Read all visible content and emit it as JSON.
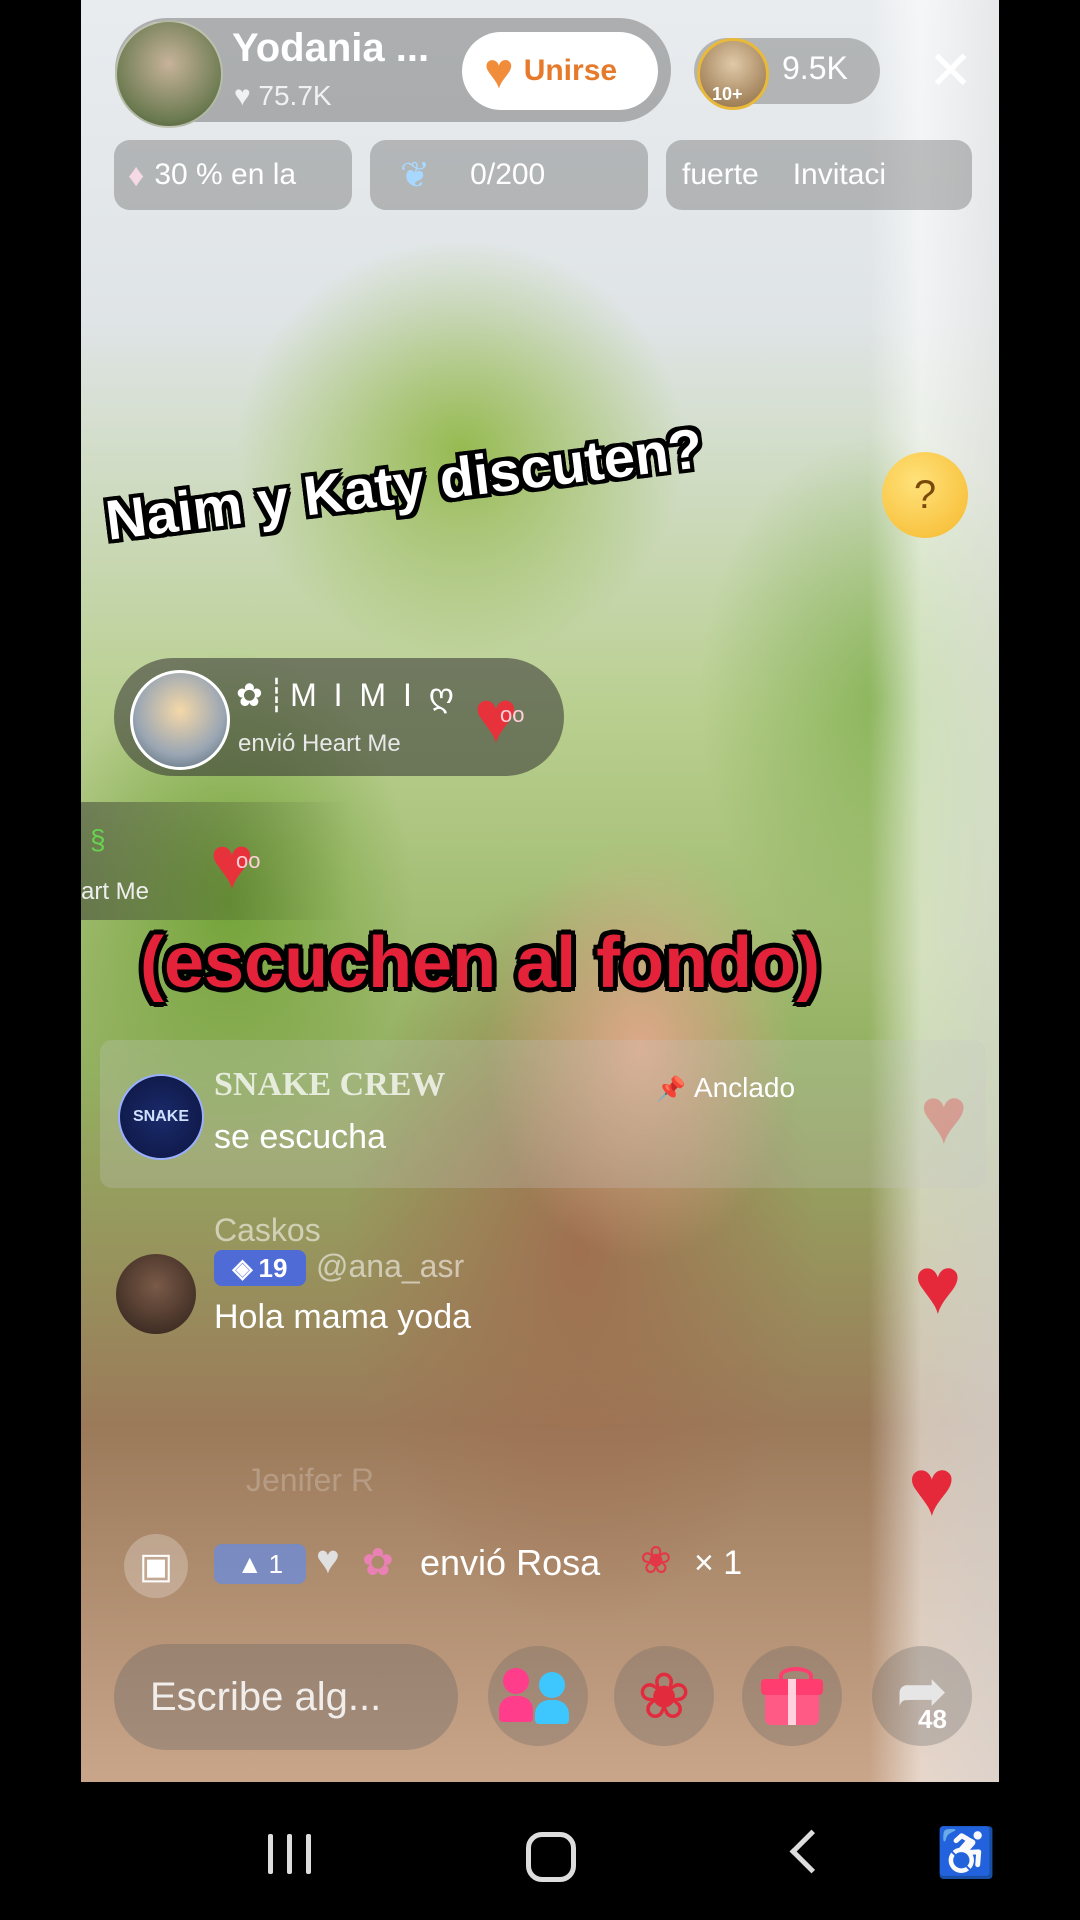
{
  "host": {
    "name": "Yodania ...",
    "likes": "75.7K",
    "join_label": "Unirse"
  },
  "viewers": {
    "badge": "10+",
    "count": "9.5K"
  },
  "chips": {
    "promo": "30 % en la",
    "progress": "0/200",
    "ticker_left": "fuerte",
    "ticker_right": "Invitaci"
  },
  "captions": {
    "line1": "Naim y Katy discuten?",
    "line2": "(escuchen al fondo)"
  },
  "gift_notifications": [
    {
      "user": "✿┊M I M I ღ",
      "text": "envió Heart Me"
    },
    {
      "user": "",
      "text": "art Me"
    }
  ],
  "chat": {
    "pinned": {
      "user": "SNAKE CREW",
      "tag": "Anclado",
      "message": "se escucha",
      "avatar_text": "SNAKE"
    },
    "messages": [
      {
        "user": "Caskos"
      },
      {
        "level": "19",
        "user": "@ana_asr",
        "message": "Hola mama yoda"
      },
      {
        "user": "Jenifer R"
      }
    ]
  },
  "gift_activity": {
    "level": "1",
    "text": "envió Rosa",
    "count": "× 1"
  },
  "input": {
    "placeholder": "Escribe alg..."
  },
  "share_count": "48",
  "colors": {
    "accent_orange": "#e67a2a",
    "caption_red": "#e4223a",
    "heart_red": "#e5283a",
    "level_blue": "#4f6bd6"
  },
  "icons": [
    "heart-icon",
    "diamond-icon",
    "swan-icon",
    "close-icon",
    "thinking-face-icon",
    "pin-icon",
    "gift-icon",
    "people-icon",
    "rose-icon",
    "share-icon"
  ]
}
